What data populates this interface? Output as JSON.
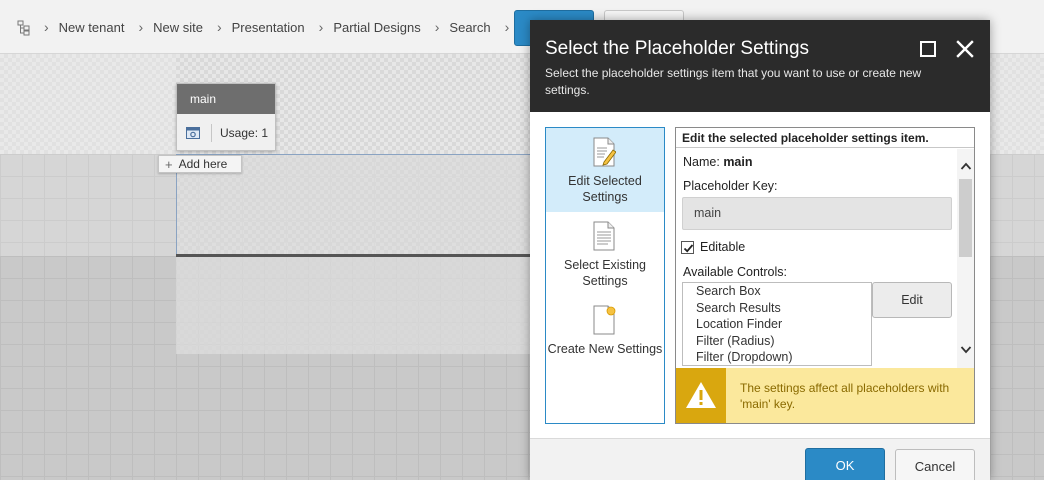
{
  "breadcrumb": [
    "New tenant",
    "New site",
    "Presentation",
    "Partial Designs",
    "Search"
  ],
  "placeholder_chrome": {
    "name": "main",
    "usage": "Usage: 1",
    "add_here": "Add here"
  },
  "dialog": {
    "title": "Select the Placeholder Settings",
    "subtitle": "Select the placeholder settings item that you want to use or create new settings.",
    "options": [
      {
        "label": "Edit Selected Settings",
        "selected": true,
        "icon": "document-edit-icon"
      },
      {
        "label": "Select Existing Settings",
        "selected": false,
        "icon": "document-icon"
      },
      {
        "label": "Create New Settings",
        "selected": false,
        "icon": "new-document-icon"
      }
    ],
    "panel": {
      "header": "Edit the selected placeholder settings item.",
      "name_label": "Name:",
      "name_value": "main",
      "key_label": "Placeholder Key:",
      "key_value": "main",
      "editable_label": "Editable",
      "editable_checked": true,
      "available_label": "Available Controls:",
      "controls": [
        "Search Box",
        "Search Results",
        "Location Finder",
        "Filter (Radius)",
        "Filter (Dropdown)"
      ],
      "edit_button": "Edit",
      "warning": "The settings affect all placeholders with 'main' key."
    },
    "ok": "OK",
    "cancel": "Cancel"
  },
  "colors": {
    "accent": "#2b8ac6",
    "header_bg": "#2b2b2b",
    "warning_bg": "#fbe89c",
    "warning_icon_bg": "#d9a70f"
  }
}
